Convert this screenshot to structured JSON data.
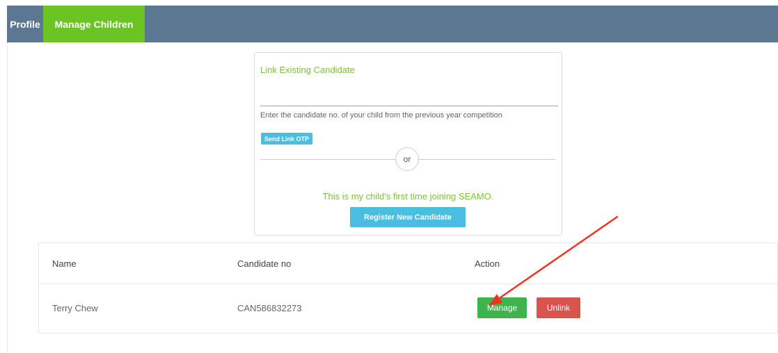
{
  "tabs": [
    {
      "label": "Profile",
      "active": false
    },
    {
      "label": "Manage Children",
      "active": true
    }
  ],
  "link_card": {
    "title": "Link Existing Candidate",
    "input_value": "",
    "help_text": "Enter the candidate no. of your child from the previous year competition",
    "otp_button": "Send Link OTP",
    "or_text": "or",
    "first_time_text": "This is my child's first time joining SEAMO.",
    "register_button": "Register New Candidate"
  },
  "table": {
    "headers": [
      "Name",
      "Candidate no",
      "Action"
    ],
    "rows": [
      {
        "name": "Terry Chew",
        "candidate_no": "CAN586832273",
        "manage_label": "Manage",
        "unlink_label": "Unlink"
      }
    ]
  },
  "colors": {
    "topbar": "#5b7791",
    "active_tab": "#6cc424",
    "accent_green_text": "#7cc33a",
    "info_blue": "#4bbde0",
    "manage_green": "#3fb34f",
    "unlink_red": "#d9534f",
    "annotation_arrow": "#ee3322"
  }
}
